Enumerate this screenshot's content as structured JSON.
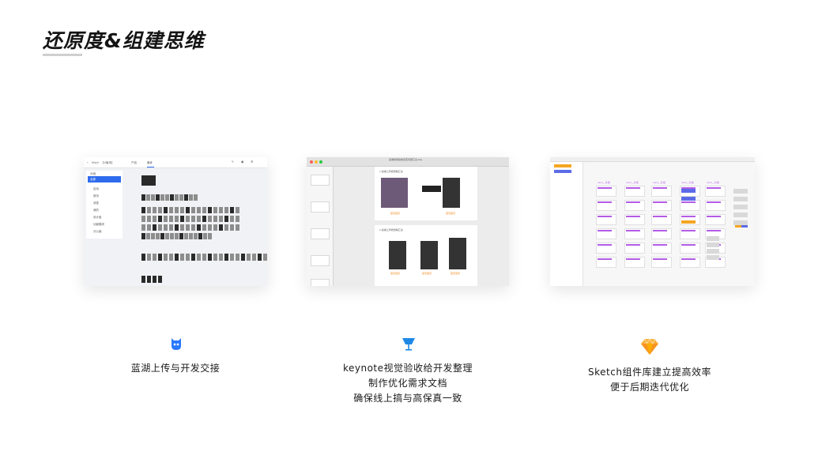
{
  "title": "还原度&组建思维",
  "accent_colors": {
    "lanhu": "#2979ff",
    "keynote": "#1e88e5",
    "sketch": "#fbb23f"
  },
  "shot1": {
    "back_label": "Vivid",
    "project_label": "【V版本】",
    "tab_product": "产品",
    "tab_design": "设计",
    "sidebar_selected": "全部",
    "sidebar_items": [
      "分组",
      "启动",
      "首页",
      "消息",
      "我的",
      "设计组",
      "功能模块",
      "分公版"
    ]
  },
  "shot2": {
    "window_title": "蓝湖视觉验收走查问题汇总.key",
    "slide_heading_1": "1.蓝湖上传视觉稿汇总",
    "slide_heading_2": "2.蓝湖上传视觉稿汇总",
    "labels": [
      "首页首页",
      "首页首页",
      "首页首页",
      "首页首页",
      "首页首页"
    ]
  },
  "shot3": {
    "group_labels": [
      "card__分组",
      "card__分组",
      "card__分组",
      "card__分组",
      "card__分组"
    ]
  },
  "features": [
    {
      "icon": "lanhu-icon",
      "lines": [
        "蓝湖上传与开发交接"
      ]
    },
    {
      "icon": "keynote-icon",
      "lines": [
        "keynote视觉验收给开发整理",
        "制作优化需求文档",
        "确保线上搞与高保真一致"
      ]
    },
    {
      "icon": "sketch-icon",
      "lines": [
        "Sketch组件库建立提高效率",
        "便于后期迭代优化"
      ]
    }
  ]
}
